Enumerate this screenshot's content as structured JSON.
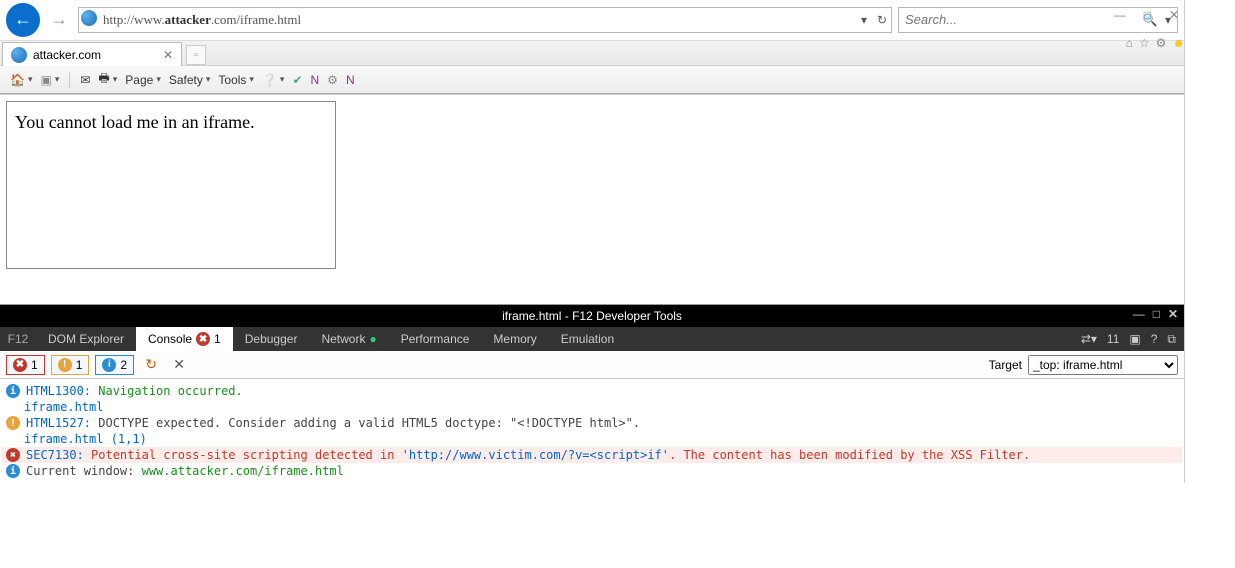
{
  "window": {
    "min": "—",
    "max": "□",
    "close": "✕"
  },
  "nav": {
    "url_prefix": "http://www.",
    "url_host": "attacker",
    "url_suffix": ".com/iframe.html",
    "refresh": "↻",
    "dropdown": "▾",
    "search_placeholder": "Search..."
  },
  "tab": {
    "title": "attacker.com"
  },
  "cmdbar": {
    "page": "Page",
    "safety": "Safety",
    "tools": "Tools"
  },
  "page": {
    "iframe_text": "You cannot load me in an iframe."
  },
  "devtools": {
    "title": "iframe.html - F12 Developer Tools",
    "f12": "F12",
    "tabs": [
      "DOM Explorer",
      "Console",
      "Debugger",
      "Network",
      "Performance",
      "Memory",
      "Emulation"
    ],
    "active_tab": 1,
    "console_badge": "1",
    "network_badge": "●",
    "header_count": "11",
    "counts": {
      "error": "1",
      "warn": "1",
      "info": "2"
    },
    "target_label": "Target",
    "target_value": "_top: iframe.html",
    "log": {
      "l1_code": "HTML1300:",
      "l1_msg": " Navigation occurred.",
      "l1_file": "iframe.html",
      "l2_code": "HTML1527:",
      "l2_msg": " DOCTYPE expected. Consider adding a valid HTML5 doctype: \"<!DOCTYPE html>\".",
      "l2_file": "iframe.html (1,1)",
      "l3_code": "SEC7130:",
      "l3_msg_a": " Potential cross-site scripting detected in ",
      "l3_url": "'http://www.victim.com/?v=<script>if'",
      "l3_msg_b": ". The content has been modified by the XSS Filter.",
      "l4_label": "Current window: ",
      "l4_val": "www.attacker.com/iframe.html"
    }
  }
}
